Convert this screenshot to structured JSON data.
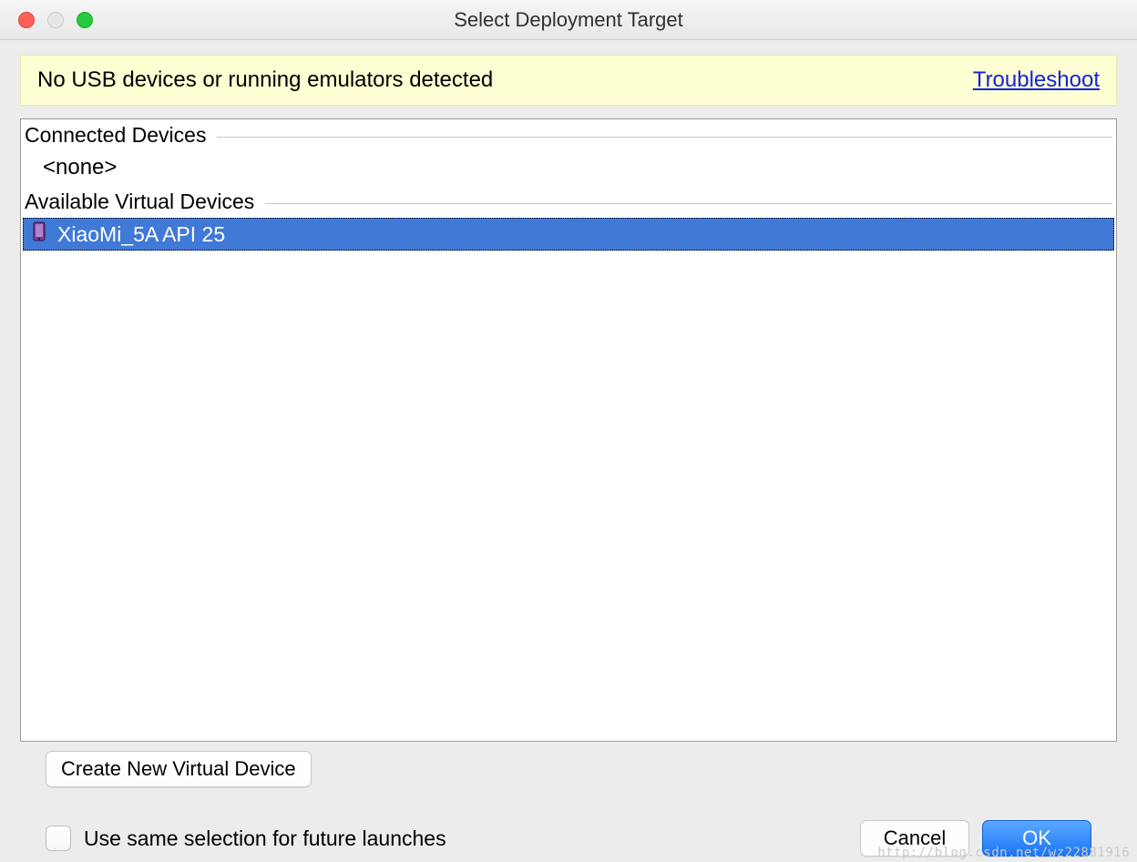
{
  "header": {
    "title": "Select Deployment Target"
  },
  "notice": {
    "message": "No USB devices or running emulators detected",
    "link_label": "Troubleshoot"
  },
  "sections": {
    "connected_label": "Connected Devices",
    "connected_none": "<none>",
    "avd_label": "Available Virtual Devices",
    "avd_items": [
      {
        "name": "XiaoMi_5A API 25",
        "selected": true
      }
    ]
  },
  "buttons": {
    "create_avd": "Create New Virtual Device",
    "cancel": "Cancel",
    "ok": "OK"
  },
  "footer": {
    "checkbox_label": "Use same selection for future launches",
    "checkbox_checked": false
  },
  "watermark": "http://blog.csdn.net/wz22881916"
}
